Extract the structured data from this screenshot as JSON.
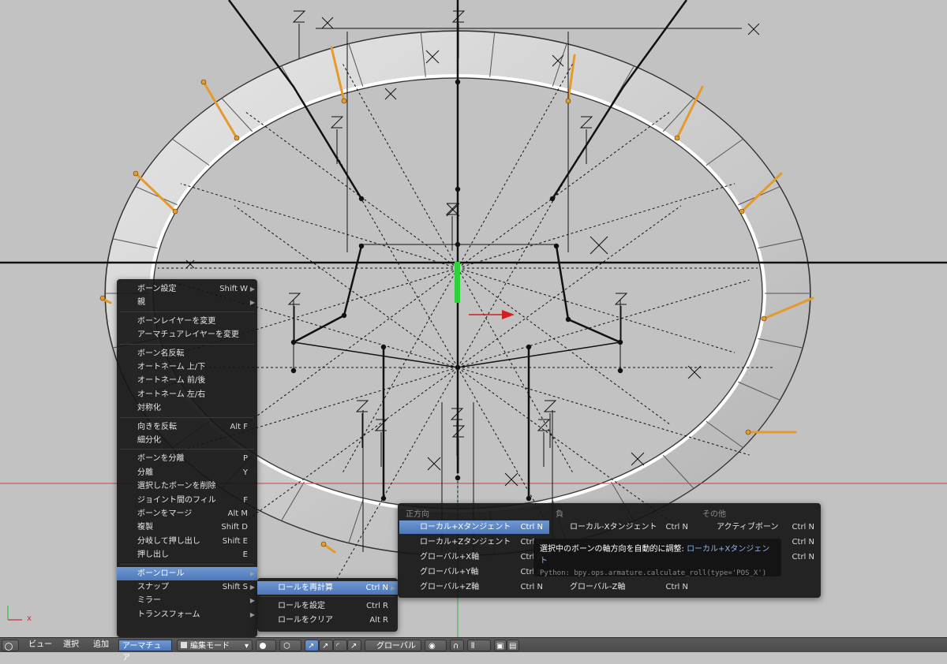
{
  "context_menu": {
    "items": [
      {
        "label": "ボーン設定",
        "shortcut": "Shift W",
        "submenu": true
      },
      {
        "label": "親",
        "shortcut": "",
        "submenu": true
      },
      {
        "label": "ボーンレイヤーを変更",
        "shortcut": ""
      },
      {
        "label": "アーマチュアレイヤーを変更",
        "shortcut": ""
      },
      {
        "label": "ボーン名反転",
        "shortcut": ""
      },
      {
        "label": "オートネーム 上/下",
        "shortcut": ""
      },
      {
        "label": "オートネーム 前/後",
        "shortcut": ""
      },
      {
        "label": "オートネーム 左/右",
        "shortcut": ""
      },
      {
        "label": "対称化",
        "shortcut": ""
      },
      {
        "label": "向きを反転",
        "shortcut": "Alt F"
      },
      {
        "label": "細分化",
        "shortcut": ""
      },
      {
        "label": "ボーンを分離",
        "shortcut": "P"
      },
      {
        "label": "分離",
        "shortcut": "Y"
      },
      {
        "label": "選択したボーンを削除",
        "shortcut": ""
      },
      {
        "label": "ジョイント間のフィル",
        "shortcut": "F"
      },
      {
        "label": "ボーンをマージ",
        "shortcut": "Alt M"
      },
      {
        "label": "複製",
        "shortcut": "Shift D"
      },
      {
        "label": "分岐して押し出し",
        "shortcut": "Shift E"
      },
      {
        "label": "押し出し",
        "shortcut": "E"
      },
      {
        "label": "ボーンロール",
        "shortcut": "",
        "submenu": true,
        "highlighted": true
      },
      {
        "label": "スナップ",
        "shortcut": "Shift S",
        "submenu": true
      },
      {
        "label": "ミラー",
        "shortcut": "",
        "submenu": true
      },
      {
        "label": "トランスフォーム",
        "shortcut": "",
        "submenu": true
      }
    ]
  },
  "roll_menu": {
    "items": [
      {
        "label": "ロールを再計算",
        "shortcut": "Ctrl N",
        "submenu": true,
        "highlighted": true
      },
      {
        "label": "ロールを設定",
        "shortcut": "Ctrl R"
      },
      {
        "label": "ロールをクリア",
        "shortcut": "Alt R"
      }
    ]
  },
  "recalc_menu": {
    "headers": {
      "positive": "正方向",
      "negative": "負",
      "other": "その他"
    },
    "positive": [
      {
        "label": "ローカル+Xタンジェント",
        "shortcut": "Ctrl N",
        "highlighted": true
      },
      {
        "label": "ローカル+Zタンジェント",
        "shortcut": "Ctrl N"
      },
      {
        "label": "グローバル+X軸",
        "shortcut": "Ctrl N"
      },
      {
        "label": "グローバル+Y軸",
        "shortcut": "Ctrl N"
      },
      {
        "label": "グローバル+Z軸",
        "shortcut": "Ctrl N"
      }
    ],
    "negative": [
      {
        "label": "ローカル-Xタンジェント",
        "shortcut": "Ctrl N"
      },
      {
        "label": "",
        "shortcut": ""
      },
      {
        "label": "",
        "shortcut": ""
      },
      {
        "label": "",
        "shortcut": ""
      },
      {
        "label": "グローバル-Z軸",
        "shortcut": "Ctrl N"
      }
    ],
    "other": [
      {
        "label": "アクティブボーン",
        "shortcut": "Ctrl N"
      },
      {
        "label": "",
        "shortcut": "Ctrl N"
      },
      {
        "label": "",
        "shortcut": "Ctrl N"
      }
    ]
  },
  "tooltip": {
    "prefix": "選択中のボーンの軸方向を自動的に調整:",
    "value": "ローカル+Xタンジェント",
    "python": "Python: bpy.ops.armature.calculate_roll(type='POS_X')"
  },
  "header": {
    "view": "ビュー",
    "select": "選択",
    "add": "追加",
    "armature": "アーマチュア",
    "mode": "編集モード",
    "orientation": "グローバル"
  },
  "axis_label": {
    "x": "x"
  },
  "colors": {
    "highlight": "#5a86c6",
    "menu_bg": "#161616",
    "header": "#4f4f4f",
    "bone_orange": "#e59a2c"
  }
}
